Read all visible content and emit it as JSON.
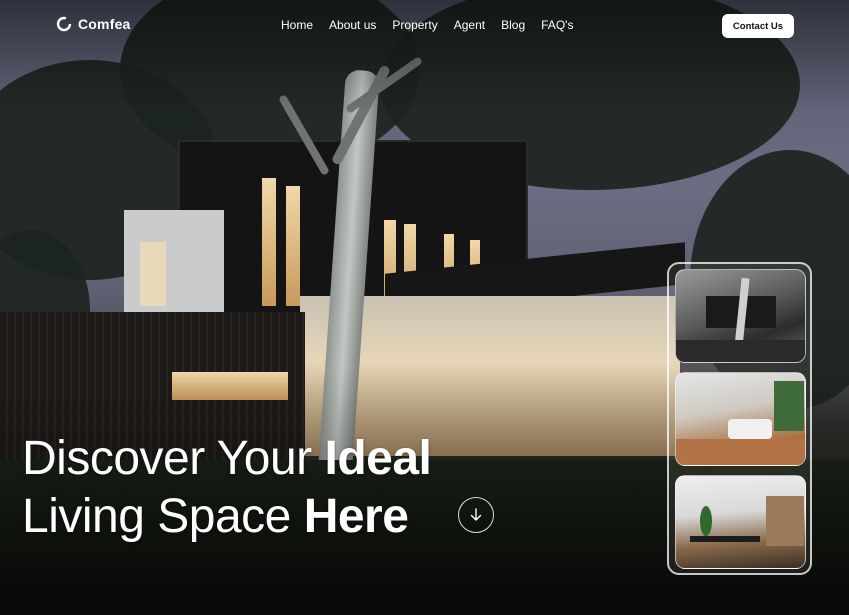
{
  "brand": {
    "name": "Comfea",
    "logo_icon": "ring-logo-icon"
  },
  "nav": {
    "items": [
      "Home",
      "About us",
      "Property",
      "Agent",
      "Blog",
      "FAQ's"
    ],
    "contact_label": "Contact Us"
  },
  "hero": {
    "line1_regular": "Discover Your ",
    "line1_bold": "Ideal",
    "line2_regular": "Living Space ",
    "line2_bold": "Here",
    "scroll_icon": "arrow-down-icon"
  },
  "gallery": {
    "thumbnails": [
      "house-exterior-thumbnail",
      "living-room-thumbnail",
      "dining-room-thumbnail"
    ]
  },
  "colors": {
    "button_bg": "#ffffff",
    "button_text": "#111111",
    "text": "#ffffff"
  }
}
